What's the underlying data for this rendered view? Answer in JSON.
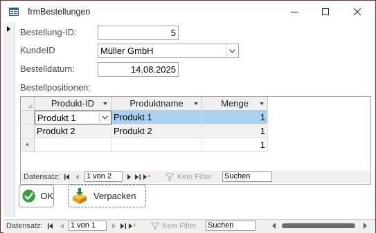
{
  "window": {
    "title": "frmBestellungen",
    "icons": {
      "app": "form-icon",
      "minimize": "minimize-icon",
      "maximize": "maximize-icon",
      "close": "close-icon"
    }
  },
  "form": {
    "bestellung_id_label": "Bestellung-ID:",
    "bestellung_id_value": "5",
    "kunde_label": "KundeID",
    "kunde_value": "Müller GmbH",
    "datum_label": "Bestelldatum:",
    "datum_value": "14.08.2025",
    "positionen_label": "Bestellpositionen:"
  },
  "subform": {
    "columns": [
      "Produkt-ID",
      "Produktname",
      "Menge"
    ],
    "rows": [
      {
        "produkt_id": "Produkt 1",
        "produktname": "Produkt 1",
        "menge": "1"
      },
      {
        "produkt_id": "Produkt 2",
        "produktname": "Produkt 2",
        "menge": "1"
      }
    ],
    "new_row_marker": "*",
    "new_row_menge": "1",
    "nav": {
      "label": "Datensatz:",
      "position": "1 von 2",
      "filter": "Kein Filter",
      "search": "Suchen"
    }
  },
  "buttons": {
    "ok_label": "OK",
    "verpacken_label": "Verpacken"
  },
  "main_nav": {
    "label": "Datensatz:",
    "position": "1 von 1",
    "filter": "Kein Filter",
    "search": "Suchen"
  }
}
